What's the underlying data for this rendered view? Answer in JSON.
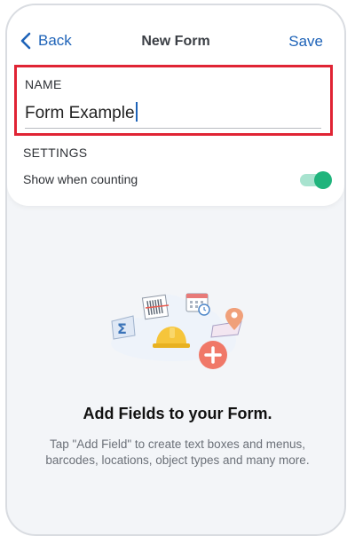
{
  "header": {
    "back_label": "Back",
    "title": "New Form",
    "save_label": "Save"
  },
  "name_field": {
    "label": "NAME",
    "value": "Form Example"
  },
  "settings": {
    "label": "SETTINGS",
    "show_when_counting": {
      "label": "Show when counting",
      "enabled": true
    }
  },
  "empty_state": {
    "title": "Add Fields to your Form.",
    "description": "Tap \"Add Field\" to create text boxes and menus, barcodes, locations, object types and many more."
  },
  "colors": {
    "accent": "#1e63b8",
    "highlight_border": "#e02434",
    "toggle_on": "#1fb47c",
    "background": "#f3f5f8"
  },
  "icons": {
    "back": "chevron-left-icon",
    "illustration": "form-fields-illustration"
  }
}
